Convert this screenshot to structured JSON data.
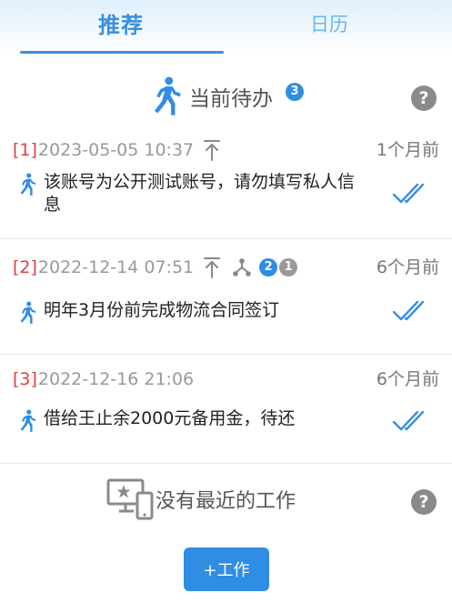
{
  "tabs": [
    {
      "label": "推荐",
      "active": true
    },
    {
      "label": "日历",
      "active": false
    }
  ],
  "todo_section": {
    "title": "当前待办",
    "count": "3",
    "help": "?"
  },
  "items": [
    {
      "index": "[1]",
      "datetime": "2023-05-05 10:37",
      "ago": "1个月前",
      "text": "该账号为公开测试账号，请勿填写私人信息",
      "pinned": true
    },
    {
      "index": "[2]",
      "datetime": "2022-12-14 07:51",
      "ago": "6个月前",
      "text": "明年3月份前完成物流合同签订",
      "pinned": true,
      "shared": true,
      "badge_blue": "2",
      "badge_gray": "1"
    },
    {
      "index": "[3]",
      "datetime": "2022-12-16 21:06",
      "ago": "6个月前",
      "text": "借给王止余2000元备用金，待还",
      "pinned": false
    }
  ],
  "recent_section": {
    "title": "没有最近的工作",
    "help": "?"
  },
  "add_button": {
    "label": "+工作"
  },
  "colors": {
    "accent": "#2f8de4",
    "index_red": "#e04040",
    "muted": "#999999"
  }
}
